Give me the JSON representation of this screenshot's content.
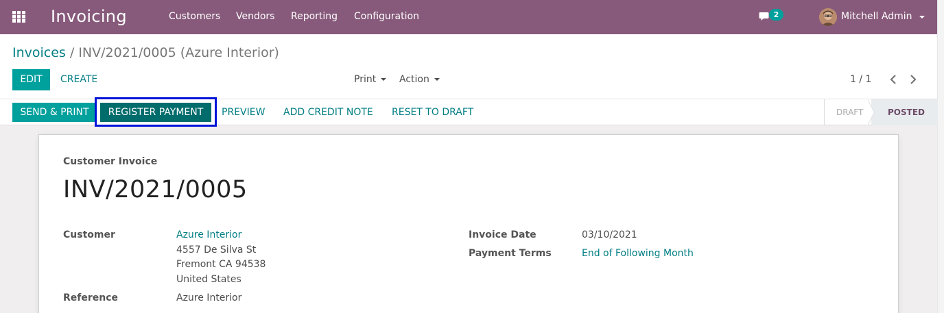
{
  "navbar": {
    "app_title": "Invoicing",
    "menu": [
      "Customers",
      "Vendors",
      "Reporting",
      "Configuration"
    ],
    "message_count": "2",
    "user_name": "Mitchell Admin"
  },
  "breadcrumb": {
    "parent": "Invoices",
    "separator": "/",
    "current": "INV/2021/0005 (Azure Interior)"
  },
  "toolbar": {
    "edit_label": "EDIT",
    "create_label": "CREATE",
    "print_label": "Print",
    "action_label": "Action",
    "pager": "1 / 1"
  },
  "statusbar": {
    "send_print_label": "SEND & PRINT",
    "register_payment_label": "REGISTER PAYMENT",
    "preview_label": "PREVIEW",
    "add_credit_note_label": "ADD CREDIT NOTE",
    "reset_to_draft_label": "RESET TO DRAFT",
    "stages": [
      "DRAFT",
      "POSTED"
    ],
    "active_stage": "POSTED"
  },
  "invoice": {
    "doc_type": "Customer Invoice",
    "number": "INV/2021/0005",
    "customer_label": "Customer",
    "customer_name": "Azure Interior",
    "address_lines": [
      "4557 De Silva St",
      "Fremont CA 94538",
      "United States"
    ],
    "reference_label": "Reference",
    "reference_value": "Azure Interior",
    "invoice_date_label": "Invoice Date",
    "invoice_date_value": "03/10/2021",
    "payment_terms_label": "Payment Terms",
    "payment_terms_value": "End of Following Month"
  },
  "colors": {
    "brand": "#875a7b",
    "primary": "#00a09d",
    "link": "#017e84",
    "highlight_border": "#0012d8"
  },
  "icons": [
    "apps-grid-icon",
    "chat-icon",
    "chevron-left-icon",
    "chevron-right-icon",
    "caret-down-icon"
  ]
}
